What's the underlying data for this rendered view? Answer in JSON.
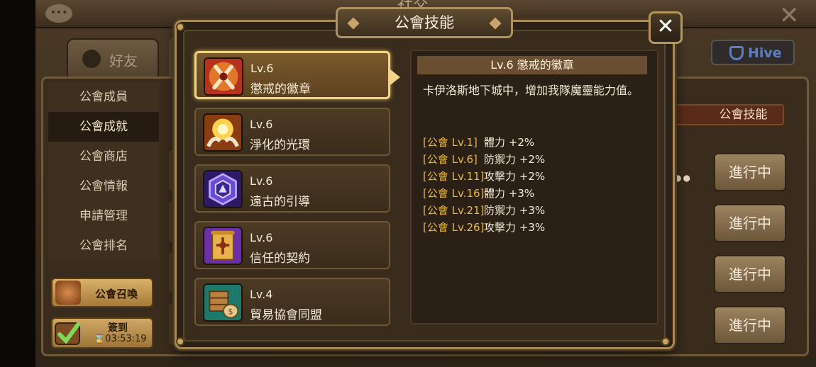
{
  "background": {
    "screen_title": "社交",
    "friend_tab_label": "好友",
    "hive_label": "Hive",
    "side_menu": [
      "公會成員",
      "公會成就",
      "公會商店",
      "公會情報",
      "申請管理",
      "公會排名"
    ],
    "side_menu_active_index": 1,
    "summon_label": "公會召喚",
    "checkin_label": "簽到",
    "checkin_timer": "⌛03:53:19",
    "guild_skill_label": "公會技能",
    "progress_labels": [
      "進行中",
      "進行中",
      "進行中",
      "進行中"
    ]
  },
  "modal": {
    "title": "公會技能",
    "close_glyph": "✕",
    "skills": [
      {
        "level": "Lv.6",
        "name": "懲戒的徽章",
        "icon": "crossed-axes-icon"
      },
      {
        "level": "Lv.6",
        "name": "淨化的光環",
        "icon": "radiant-hands-icon"
      },
      {
        "level": "Lv.6",
        "name": "遠古的引導",
        "icon": "rune-hexagon-icon"
      },
      {
        "level": "Lv.6",
        "name": "信任的契約",
        "icon": "contract-scroll-icon"
      },
      {
        "level": "Lv.4",
        "name": "貿易協會同盟",
        "icon": "trade-crate-icon"
      }
    ],
    "selected_index": 0,
    "detail": {
      "header": "Lv.6 懲戒的徽章",
      "description": "卡伊洛斯地下城中，增加我隊魔靈能力值。",
      "bonuses": [
        {
          "tag": "[公會 Lv.1]",
          "effect": "體力 +2%"
        },
        {
          "tag": "[公會 Lv.6]",
          "effect": "防禦力 +2%"
        },
        {
          "tag": "[公會 Lv.11]",
          "effect": "攻擊力 +2%"
        },
        {
          "tag": "[公會 Lv.16]",
          "effect": "體力 +3%"
        },
        {
          "tag": "[公會 Lv.21]",
          "effect": "防禦力 +3%"
        },
        {
          "tag": "[公會 Lv.26]",
          "effect": "攻擊力 +3%"
        }
      ]
    }
  },
  "colors": {
    "accent_gold": "#f1d488",
    "bonus_tag": "#e8b745"
  }
}
